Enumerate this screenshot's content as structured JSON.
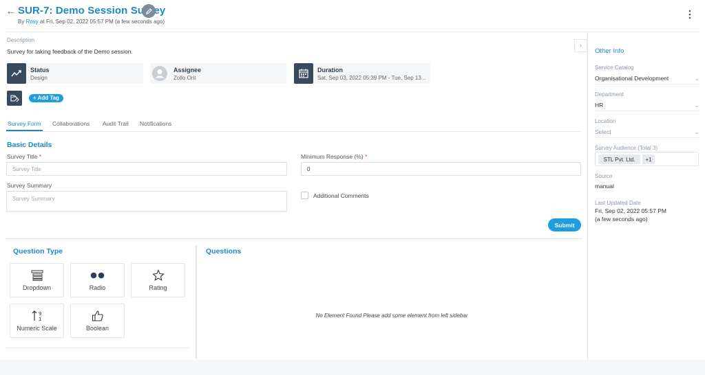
{
  "header": {
    "title": "SUR-7: Demo Session Survey",
    "by_prefix": "By",
    "author": "Rosy",
    "timestamp": "at Fri, Sep 02, 2022 05:57 PM (a few seconds ago)"
  },
  "description": {
    "label": "Description",
    "text": "Survey for taking feedback of the Demo session."
  },
  "cards": {
    "status": {
      "label": "Status",
      "value": "Design"
    },
    "assignee": {
      "label": "Assignee",
      "value": "Zollo Orit"
    },
    "duration": {
      "label": "Duration",
      "value": "Sat, Sep 03, 2022 05:39 PM - Tue, Sep 13..."
    }
  },
  "add_tag_label": "+ Add Tag",
  "tabs": [
    "Survey Form",
    "Collaborations",
    "Audit Trail",
    "Notifications"
  ],
  "form": {
    "section_title": "Basic Details",
    "survey_title_label": "Survey Title",
    "survey_title_placeholder": "Survey Title",
    "min_response_label": "Minimum Response (%)",
    "min_response_value": "0",
    "survey_summary_label": "Survey Summary",
    "survey_summary_placeholder": "Survey Summary",
    "additional_comments_label": "Additional Comments",
    "submit_label": "Submit",
    "required_mark": "*"
  },
  "question_type": {
    "title": "Question Type",
    "items": [
      "Dropdown",
      "Radio",
      "Rating",
      "Numeric Scale",
      "Boolean"
    ]
  },
  "questions": {
    "title": "Questions",
    "empty_message": "No Element Found Please add some element from left sidebar"
  },
  "sidebar": {
    "title": "Other Info",
    "service_catalog": {
      "label": "Service Catalog",
      "value": "Organisational Development"
    },
    "department": {
      "label": "Department",
      "value": "HR"
    },
    "location": {
      "label": "Location",
      "value": "Select"
    },
    "survey_audience": {
      "label": "Survey Audience (Total 3)",
      "chip": "STL Pvt. Ltd.",
      "more": "+1"
    },
    "source": {
      "label": "Source",
      "value": "manual"
    },
    "last_updated": {
      "label": "Last Updated Date",
      "value": "Fri, Sep 02, 2022 05:57 PM",
      "relative": "(a few seconds ago)"
    }
  },
  "colors": {
    "accent": "#1e88c7",
    "button": "#1e9de0",
    "dark_icon_bg": "#3a4a5d",
    "required": "#e53935"
  }
}
